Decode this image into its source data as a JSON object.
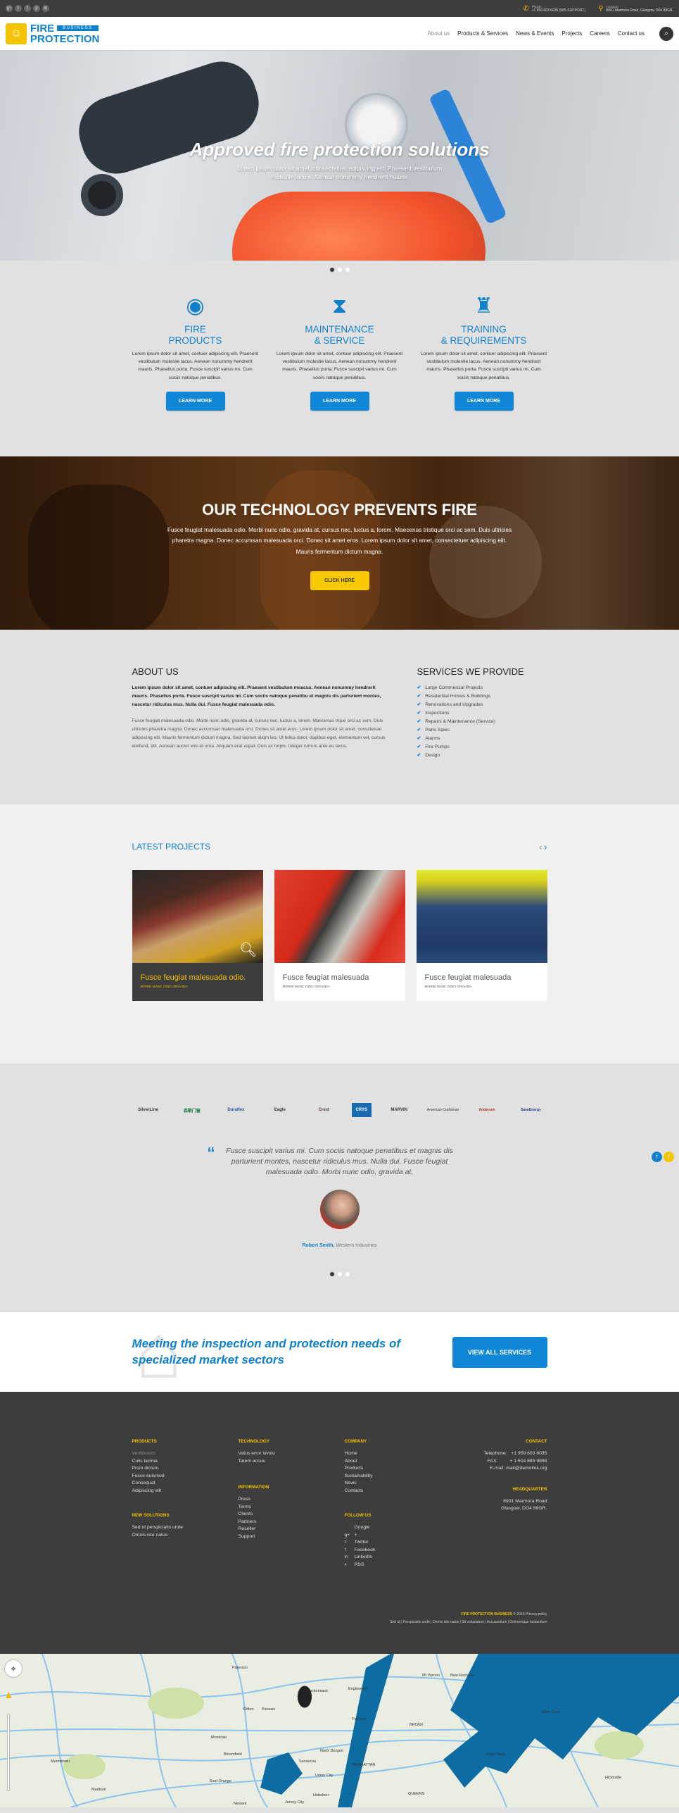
{
  "topbar": {
    "socials": [
      "google-plus",
      "twitter",
      "facebook",
      "pinterest",
      "linkedin"
    ],
    "social_glyphs": [
      "g+",
      "t",
      "f",
      "p",
      "in"
    ],
    "phone_label": "Phone:",
    "phone_value": "+1 959 603 6035 (585-SUPPORT)",
    "location_label": "Location:",
    "location_value": "8901 Marmora Road, Glasgow, D04 89GR."
  },
  "logo": {
    "line1": "FIRE",
    "badge": "BUSINESS",
    "line2": "PROTECTION"
  },
  "nav": {
    "items": [
      "About us",
      "Products & Services",
      "News & Events",
      "Projects",
      "Careers",
      "Contact us"
    ],
    "active_index": 0
  },
  "hero": {
    "title": "Approved fire protection solutions",
    "subtitle": "Lorem ipsum dolor sit amet, consectetuer adipiscing elit. Praesent vestibulum molestie lacu s. Aenean nonummy hendrerit mauris",
    "slide_count": 3,
    "active_slide": 1
  },
  "features": [
    {
      "icon": "fire-alarm-icon",
      "glyph": "◉",
      "title_1": "FIRE",
      "title_2": "PRODUCTS",
      "text": "Lorem ipsum dolor sit amet, contuer adipiscing elit. Praesent vestibulum molestie lacus. Aenean nonummy hendrerit mauris. Phasellus porta. Fusce suscipit varius mi. Cum sociis natoque penatibus.",
      "button": "LEARN MORE"
    },
    {
      "icon": "fire-hose-icon",
      "glyph": "⧗",
      "title_1": "MAINTENANCE",
      "title_2": "& SERVICE",
      "text": "Lorem ipsum dolor sit amet, contuer adipiscing elit. Praesent vestibulum molestie lacus. Aenean nonummy hendrerit mauris. Phasellus porta. Fusce suscipit varius mi. Cum sociis natoque penatibus.",
      "button": "LEARN MORE"
    },
    {
      "icon": "fire-hydrant-icon",
      "glyph": "♜",
      "title_1": "TRAINING",
      "title_2": "& REQUIREMENTS",
      "text": "Lorem ipsum dolor sit amet, contuer adipiscing elit. Praesent vestibulum molestie lacus. Aenean nonummy hendrerit mauris. Phasellus porta. Fusce suscipit varius mi. Cum sociis natoque penatibus.",
      "button": "LEARN MORE"
    }
  ],
  "technology": {
    "title": "OUR TECHNOLOGY PREVENTS FIRE",
    "text": "Fusce feugiat malesuada odio. Morbi nunc odio, gravida at, cursus nec, luctus a, lorem. Maecenas tristique orci ac sem. Duis ultricies pharetra magna. Donec accumsan malesuada orci. Donec sit amet eros. Lorem ipsum dolor sit amet, consectetuer adipiscing elit. Mauris fermentum dictum magna.",
    "button": "CLICK HERE"
  },
  "about": {
    "title": "ABOUT US",
    "bold": "Lorem ipsum dolor sit amet, contuer adipiscing elit. Praesent vestibulum moacus. Aenean nonummy hendrerit mauris. Phasellus porta. Fusce suscipit varius mi. Cum sociis natoque penatibu et magnis dis parturient montes, nascetur ridiculus mus. Nulla dui. Fusce feugiat malesuada odio.",
    "text": "Fusce feugiat malesuada odio. Morbi nunc odio, gravida at, cursus nec, luctus a, lorem. Maecenas trque orci ac sem. Duis ultricies pharetra magna. Donec accumsan malesuada orci. Donec sit amet eros. Lorem ipsum dolor sit amet, consctetuer adipiscing elit. Mauris fermentum dictum magna. Sed laoreet aliqm leo. Ut tellus dolor, dapibus eget, elementum vel, cursus eleifend, elit. Aenean auctor wisi et urna. Aliquam erat vopat. Duis ac turpis. Integer rutrum ante eu lacus."
  },
  "services": {
    "title": "SERVICES WE PROVIDE",
    "items": [
      "Large Commercial Projects",
      "Residential Homes & Buildings",
      "Renovations and Upgrades",
      "Inspections",
      "Repairs & Maintenance (Service)",
      "Parts Sales",
      "Alarms",
      "Fire Pumps",
      "Design"
    ]
  },
  "projects": {
    "title": "LATEST PROJECTS",
    "prev": "‹",
    "next": "›",
    "items": [
      {
        "title": "Fusce feugiat malesuada odio.",
        "subtitle": "MORBI NUNC ODIO GRAVIDA",
        "active": true
      },
      {
        "title": "Fusce feugiat malesuada",
        "subtitle": "MORBI NUNC ODIO GRAVIDA",
        "active": false
      },
      {
        "title": "Fusce feugiat malesuada",
        "subtitle": "MORBI NUNC ODIO GRAVIDA",
        "active": false
      }
    ]
  },
  "partners": [
    "SilverLine",
    "森歌门窗",
    "Duraflex",
    "Eagle",
    "Crest",
    "CRYS",
    "MARVIN",
    "American Craftsman",
    "Andersen",
    "SaveEnergy"
  ],
  "testimonial": {
    "quote": "Fusce suscipit varius mi. Cum sociis natoque penatibus et magnis dis parturient montes, nascetur ridiculus mus. Nulla dui. Fusce feugiat malesuada odio. Morbi nunc odio, gravida at.",
    "author": "Robert Smith,",
    "company": "Western Industries",
    "slide_count": 3,
    "active_slide": 1
  },
  "cta": {
    "text": "Meeting the inspection and protection needs of specialized market sectors",
    "button": "VIEW ALL SERVICES"
  },
  "footer": {
    "products": {
      "title": "PRODUCTS",
      "items": [
        "Vestibulum",
        "Culis lacinia",
        "Proin dictum",
        "Fusce euismod",
        "Consequat",
        "Adipiscing elit"
      ]
    },
    "new_solutions": {
      "title": "NEW SOLUTIONS",
      "items": [
        "Sed ut perspiciatis unde",
        "Omnis iste natus"
      ]
    },
    "technology": {
      "title": "TECHNOLOGY",
      "items": [
        "Vatus error sivolu",
        "Tatem accus"
      ]
    },
    "information": {
      "title": "INFORMATION",
      "items": [
        "Press",
        "Terms",
        "Clients",
        "Partners",
        "Reseller",
        "Support"
      ]
    },
    "company": {
      "title": "COMPANY",
      "items": [
        "Home",
        "About",
        "Products",
        "Sustainability",
        "News",
        "Contacts"
      ]
    },
    "follow": {
      "title": "FOLLOW US",
      "items": [
        {
          "glyph": "g+",
          "label": "Google +"
        },
        {
          "glyph": "t",
          "label": "Twitter"
        },
        {
          "glyph": "f",
          "label": "Facebook"
        },
        {
          "glyph": "in",
          "label": "LinkedIn"
        },
        {
          "glyph": "◗",
          "label": "RSS"
        }
      ]
    },
    "contact": {
      "title": "CONTACT",
      "telephone_label": "Telephone:",
      "telephone": "+1 959 603 6035",
      "fax_label": "FAX:",
      "fax": "+ 1 504 889 9898",
      "email_label": "E-mail:",
      "email": "mail@demolink.org"
    },
    "headquarter": {
      "title": "HEADQUARTER",
      "line1": "8901 Marmora Road",
      "line2": "Glasgow, DO4 89GR."
    },
    "brand": "FIRE PROTECTION BUSINESS",
    "copyright": "© 2015",
    "privacy": "Privacy policy",
    "links": [
      "Sed ut",
      "Perspiciatis unde",
      "Omnis iste natus",
      "Sit voluptatem",
      "Accusantium",
      "Doloremque laudantium"
    ]
  },
  "map": {
    "labels": [
      "Paterson",
      "Clifton",
      "Passaic",
      "Hackensack",
      "Englewood",
      "Montclair",
      "Bloomfield",
      "Newark",
      "Jersey City",
      "Hoboken",
      "Union City",
      "MANHATTAN",
      "BRONX",
      "QUEENS",
      "Mt Vernon",
      "New Rochelle",
      "Glen Cove",
      "Morristown",
      "Madison",
      "East Orange",
      "Fort Lee",
      "North Bergen",
      "Secaucus",
      "Great Neck",
      "Hicksville"
    ]
  }
}
